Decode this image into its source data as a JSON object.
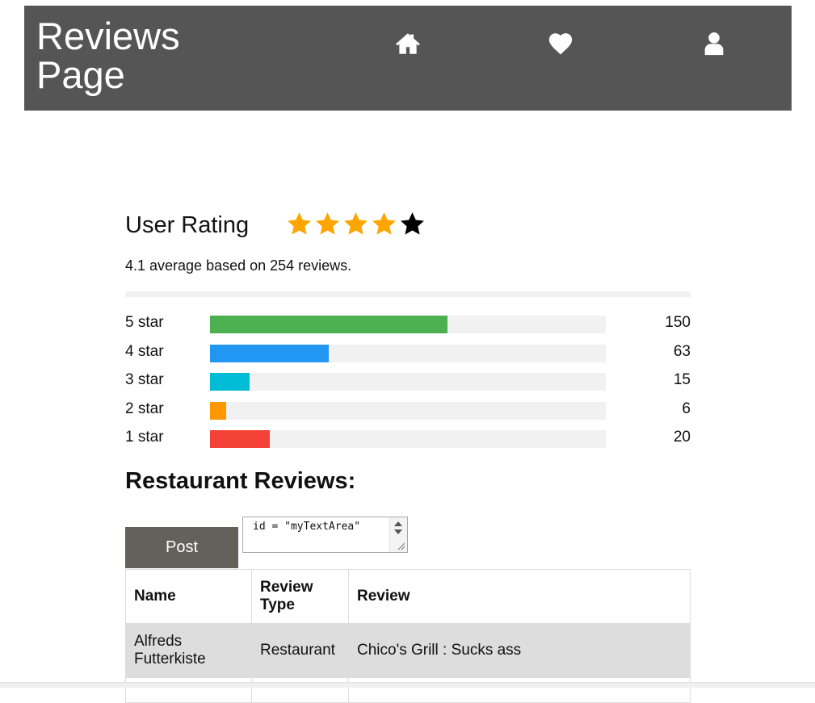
{
  "header": {
    "title": "Reviews Page",
    "nav": [
      {
        "icon": "home-icon"
      },
      {
        "icon": "heart-icon"
      },
      {
        "icon": "user-icon"
      }
    ]
  },
  "rating": {
    "heading": "User Rating",
    "stars_filled": 4,
    "stars_total": 5,
    "summary": "4.1 average based on 254 reviews.",
    "filled_color": "#ffa500",
    "empty_color": "#000000"
  },
  "bars": [
    {
      "label": "5 star",
      "count": "150",
      "fraction": 0.6,
      "color": "#4caf50"
    },
    {
      "label": "4 star",
      "count": "63",
      "fraction": 0.3,
      "color": "#2196f3"
    },
    {
      "label": "3 star",
      "count": "15",
      "fraction": 0.1,
      "color": "#00bcd4"
    },
    {
      "label": "2 star",
      "count": "6",
      "fraction": 0.04,
      "color": "#ff9800"
    },
    {
      "label": "1 star",
      "count": "20",
      "fraction": 0.15,
      "color": "#f44336"
    }
  ],
  "reviews": {
    "heading": "Restaurant Reviews:",
    "post_label": "Post",
    "textarea_value": "id = \"myTextArea\"",
    "columns": [
      "Name",
      "Review Type",
      "Review"
    ],
    "rows": [
      {
        "name": "Alfreds Futterkiste",
        "type": "Restaurant",
        "review": "Chico's Grill : Sucks ass"
      },
      {
        "name": "",
        "type": "",
        "review": ""
      }
    ]
  }
}
